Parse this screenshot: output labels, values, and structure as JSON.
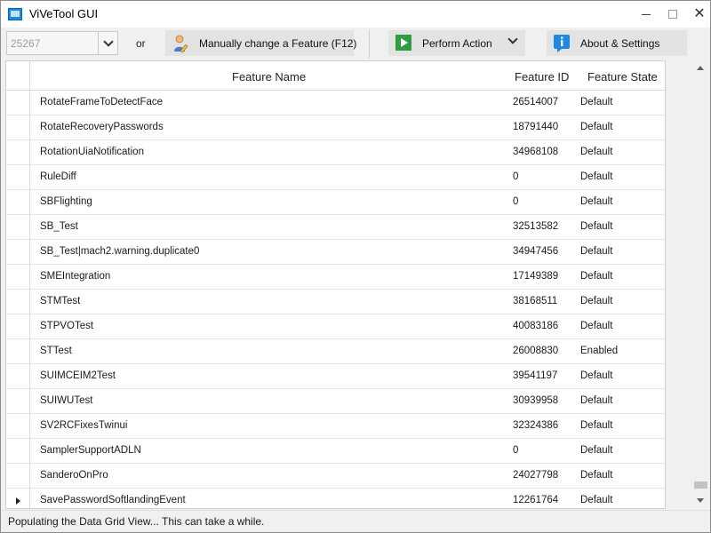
{
  "window": {
    "title": "ViVeTool GUI",
    "minimize_label": "–",
    "close_label": "✕"
  },
  "toolbar": {
    "build_value": "25267",
    "or_label": "or",
    "manual_label": "Manually change a Feature (F12)",
    "perform_label": "Perform Action",
    "about_label": "About & Settings"
  },
  "grid": {
    "columns": [
      "Feature Name",
      "Feature ID",
      "Feature State"
    ],
    "rows": [
      {
        "name": "RotateFrameToDetectFace",
        "id": "26514007",
        "state": "Default"
      },
      {
        "name": "RotateRecoveryPasswords",
        "id": "18791440",
        "state": "Default"
      },
      {
        "name": "RotationUiaNotification",
        "id": "34968108",
        "state": "Default"
      },
      {
        "name": "RuleDiff",
        "id": "0",
        "state": "Default"
      },
      {
        "name": "SBFlighting",
        "id": "0",
        "state": "Default"
      },
      {
        "name": "SB_Test",
        "id": "32513582",
        "state": "Default"
      },
      {
        "name": "SB_Test|mach2.warning.duplicate0",
        "id": "34947456",
        "state": "Default"
      },
      {
        "name": "SMEIntegration",
        "id": "17149389",
        "state": "Default"
      },
      {
        "name": "STMTest",
        "id": "38168511",
        "state": "Default"
      },
      {
        "name": "STPVOTest",
        "id": "40083186",
        "state": "Default"
      },
      {
        "name": "STTest",
        "id": "26008830",
        "state": "Enabled"
      },
      {
        "name": "SUIMCEIM2Test",
        "id": "39541197",
        "state": "Default"
      },
      {
        "name": "SUIWUTest",
        "id": "30939958",
        "state": "Default"
      },
      {
        "name": "SV2RCFixesTwinui",
        "id": "32324386",
        "state": "Default"
      },
      {
        "name": "SamplerSupportADLN",
        "id": "0",
        "state": "Default"
      },
      {
        "name": "SanderoOnPro",
        "id": "24027798",
        "state": "Default"
      },
      {
        "name": "SavePasswordSoftlandingEvent",
        "id": "12261764",
        "state": "Default"
      }
    ]
  },
  "status": {
    "text": "Populating the Data Grid View... This can take a while."
  },
  "colors": {
    "accent": "#1e88e5",
    "button_bg": "#e3e3e3",
    "play_green": "#2e9e3f",
    "info_blue": "#1e88e5"
  }
}
